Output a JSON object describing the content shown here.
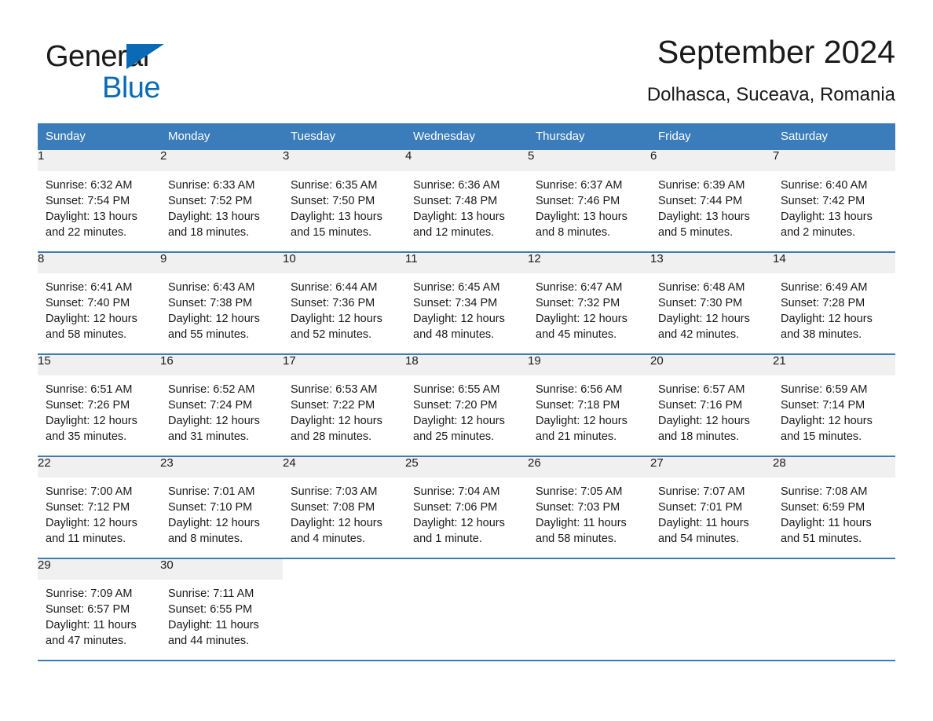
{
  "brand": {
    "line1": "General",
    "line2": "Blue",
    "triangle_color": "#0a6ab5",
    "logo_icon": "triangle-logo-icon"
  },
  "header": {
    "title": "September 2024",
    "subtitle": "Dolhasca, Suceava, Romania"
  },
  "theme": {
    "header_bg": "#3b7cba",
    "daynum_bg": "#f0f0f0",
    "text": "#1a1a1a",
    "page_bg": "#ffffff"
  },
  "calendar": {
    "weekday_headers": [
      "Sunday",
      "Monday",
      "Tuesday",
      "Wednesday",
      "Thursday",
      "Friday",
      "Saturday"
    ],
    "weeks": [
      [
        {
          "day": "1",
          "sunrise": "Sunrise: 6:32 AM",
          "sunset": "Sunset: 7:54 PM",
          "daylight_1": "Daylight: 13 hours",
          "daylight_2": "and 22 minutes."
        },
        {
          "day": "2",
          "sunrise": "Sunrise: 6:33 AM",
          "sunset": "Sunset: 7:52 PM",
          "daylight_1": "Daylight: 13 hours",
          "daylight_2": "and 18 minutes."
        },
        {
          "day": "3",
          "sunrise": "Sunrise: 6:35 AM",
          "sunset": "Sunset: 7:50 PM",
          "daylight_1": "Daylight: 13 hours",
          "daylight_2": "and 15 minutes."
        },
        {
          "day": "4",
          "sunrise": "Sunrise: 6:36 AM",
          "sunset": "Sunset: 7:48 PM",
          "daylight_1": "Daylight: 13 hours",
          "daylight_2": "and 12 minutes."
        },
        {
          "day": "5",
          "sunrise": "Sunrise: 6:37 AM",
          "sunset": "Sunset: 7:46 PM",
          "daylight_1": "Daylight: 13 hours",
          "daylight_2": "and 8 minutes."
        },
        {
          "day": "6",
          "sunrise": "Sunrise: 6:39 AM",
          "sunset": "Sunset: 7:44 PM",
          "daylight_1": "Daylight: 13 hours",
          "daylight_2": "and 5 minutes."
        },
        {
          "day": "7",
          "sunrise": "Sunrise: 6:40 AM",
          "sunset": "Sunset: 7:42 PM",
          "daylight_1": "Daylight: 13 hours",
          "daylight_2": "and 2 minutes."
        }
      ],
      [
        {
          "day": "8",
          "sunrise": "Sunrise: 6:41 AM",
          "sunset": "Sunset: 7:40 PM",
          "daylight_1": "Daylight: 12 hours",
          "daylight_2": "and 58 minutes."
        },
        {
          "day": "9",
          "sunrise": "Sunrise: 6:43 AM",
          "sunset": "Sunset: 7:38 PM",
          "daylight_1": "Daylight: 12 hours",
          "daylight_2": "and 55 minutes."
        },
        {
          "day": "10",
          "sunrise": "Sunrise: 6:44 AM",
          "sunset": "Sunset: 7:36 PM",
          "daylight_1": "Daylight: 12 hours",
          "daylight_2": "and 52 minutes."
        },
        {
          "day": "11",
          "sunrise": "Sunrise: 6:45 AM",
          "sunset": "Sunset: 7:34 PM",
          "daylight_1": "Daylight: 12 hours",
          "daylight_2": "and 48 minutes."
        },
        {
          "day": "12",
          "sunrise": "Sunrise: 6:47 AM",
          "sunset": "Sunset: 7:32 PM",
          "daylight_1": "Daylight: 12 hours",
          "daylight_2": "and 45 minutes."
        },
        {
          "day": "13",
          "sunrise": "Sunrise: 6:48 AM",
          "sunset": "Sunset: 7:30 PM",
          "daylight_1": "Daylight: 12 hours",
          "daylight_2": "and 42 minutes."
        },
        {
          "day": "14",
          "sunrise": "Sunrise: 6:49 AM",
          "sunset": "Sunset: 7:28 PM",
          "daylight_1": "Daylight: 12 hours",
          "daylight_2": "and 38 minutes."
        }
      ],
      [
        {
          "day": "15",
          "sunrise": "Sunrise: 6:51 AM",
          "sunset": "Sunset: 7:26 PM",
          "daylight_1": "Daylight: 12 hours",
          "daylight_2": "and 35 minutes."
        },
        {
          "day": "16",
          "sunrise": "Sunrise: 6:52 AM",
          "sunset": "Sunset: 7:24 PM",
          "daylight_1": "Daylight: 12 hours",
          "daylight_2": "and 31 minutes."
        },
        {
          "day": "17",
          "sunrise": "Sunrise: 6:53 AM",
          "sunset": "Sunset: 7:22 PM",
          "daylight_1": "Daylight: 12 hours",
          "daylight_2": "and 28 minutes."
        },
        {
          "day": "18",
          "sunrise": "Sunrise: 6:55 AM",
          "sunset": "Sunset: 7:20 PM",
          "daylight_1": "Daylight: 12 hours",
          "daylight_2": "and 25 minutes."
        },
        {
          "day": "19",
          "sunrise": "Sunrise: 6:56 AM",
          "sunset": "Sunset: 7:18 PM",
          "daylight_1": "Daylight: 12 hours",
          "daylight_2": "and 21 minutes."
        },
        {
          "day": "20",
          "sunrise": "Sunrise: 6:57 AM",
          "sunset": "Sunset: 7:16 PM",
          "daylight_1": "Daylight: 12 hours",
          "daylight_2": "and 18 minutes."
        },
        {
          "day": "21",
          "sunrise": "Sunrise: 6:59 AM",
          "sunset": "Sunset: 7:14 PM",
          "daylight_1": "Daylight: 12 hours",
          "daylight_2": "and 15 minutes."
        }
      ],
      [
        {
          "day": "22",
          "sunrise": "Sunrise: 7:00 AM",
          "sunset": "Sunset: 7:12 PM",
          "daylight_1": "Daylight: 12 hours",
          "daylight_2": "and 11 minutes."
        },
        {
          "day": "23",
          "sunrise": "Sunrise: 7:01 AM",
          "sunset": "Sunset: 7:10 PM",
          "daylight_1": "Daylight: 12 hours",
          "daylight_2": "and 8 minutes."
        },
        {
          "day": "24",
          "sunrise": "Sunrise: 7:03 AM",
          "sunset": "Sunset: 7:08 PM",
          "daylight_1": "Daylight: 12 hours",
          "daylight_2": "and 4 minutes."
        },
        {
          "day": "25",
          "sunrise": "Sunrise: 7:04 AM",
          "sunset": "Sunset: 7:06 PM",
          "daylight_1": "Daylight: 12 hours",
          "daylight_2": "and 1 minute."
        },
        {
          "day": "26",
          "sunrise": "Sunrise: 7:05 AM",
          "sunset": "Sunset: 7:03 PM",
          "daylight_1": "Daylight: 11 hours",
          "daylight_2": "and 58 minutes."
        },
        {
          "day": "27",
          "sunrise": "Sunrise: 7:07 AM",
          "sunset": "Sunset: 7:01 PM",
          "daylight_1": "Daylight: 11 hours",
          "daylight_2": "and 54 minutes."
        },
        {
          "day": "28",
          "sunrise": "Sunrise: 7:08 AM",
          "sunset": "Sunset: 6:59 PM",
          "daylight_1": "Daylight: 11 hours",
          "daylight_2": "and 51 minutes."
        }
      ],
      [
        {
          "day": "29",
          "sunrise": "Sunrise: 7:09 AM",
          "sunset": "Sunset: 6:57 PM",
          "daylight_1": "Daylight: 11 hours",
          "daylight_2": "and 47 minutes."
        },
        {
          "day": "30",
          "sunrise": "Sunrise: 7:11 AM",
          "sunset": "Sunset: 6:55 PM",
          "daylight_1": "Daylight: 11 hours",
          "daylight_2": "and 44 minutes."
        },
        {
          "day": "",
          "sunrise": "",
          "sunset": "",
          "daylight_1": "",
          "daylight_2": ""
        },
        {
          "day": "",
          "sunrise": "",
          "sunset": "",
          "daylight_1": "",
          "daylight_2": ""
        },
        {
          "day": "",
          "sunrise": "",
          "sunset": "",
          "daylight_1": "",
          "daylight_2": ""
        },
        {
          "day": "",
          "sunrise": "",
          "sunset": "",
          "daylight_1": "",
          "daylight_2": ""
        },
        {
          "day": "",
          "sunrise": "",
          "sunset": "",
          "daylight_1": "",
          "daylight_2": ""
        }
      ]
    ]
  }
}
